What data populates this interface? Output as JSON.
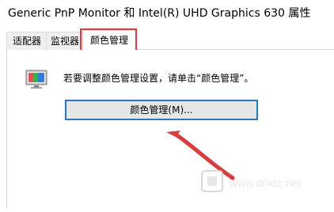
{
  "window": {
    "title": "Generic PnP Monitor 和 Intel(R) UHD Graphics 630 属性"
  },
  "tabs": [
    {
      "label": "适配器"
    },
    {
      "label": "监视器"
    },
    {
      "label": "颜色管理"
    }
  ],
  "color_management": {
    "description": "若要调整颜色管理设置，请单击“颜色管理”。",
    "button_label": "颜色管理(M)..."
  },
  "watermark": {
    "text": "www.dnxtc.net"
  },
  "colors": {
    "highlight": "#e03b3b",
    "button_border": "#1f7bd1",
    "arrow": "#e03b3b"
  },
  "icons": [
    "monitor-color-icon",
    "arrow-pointer-icon"
  ]
}
